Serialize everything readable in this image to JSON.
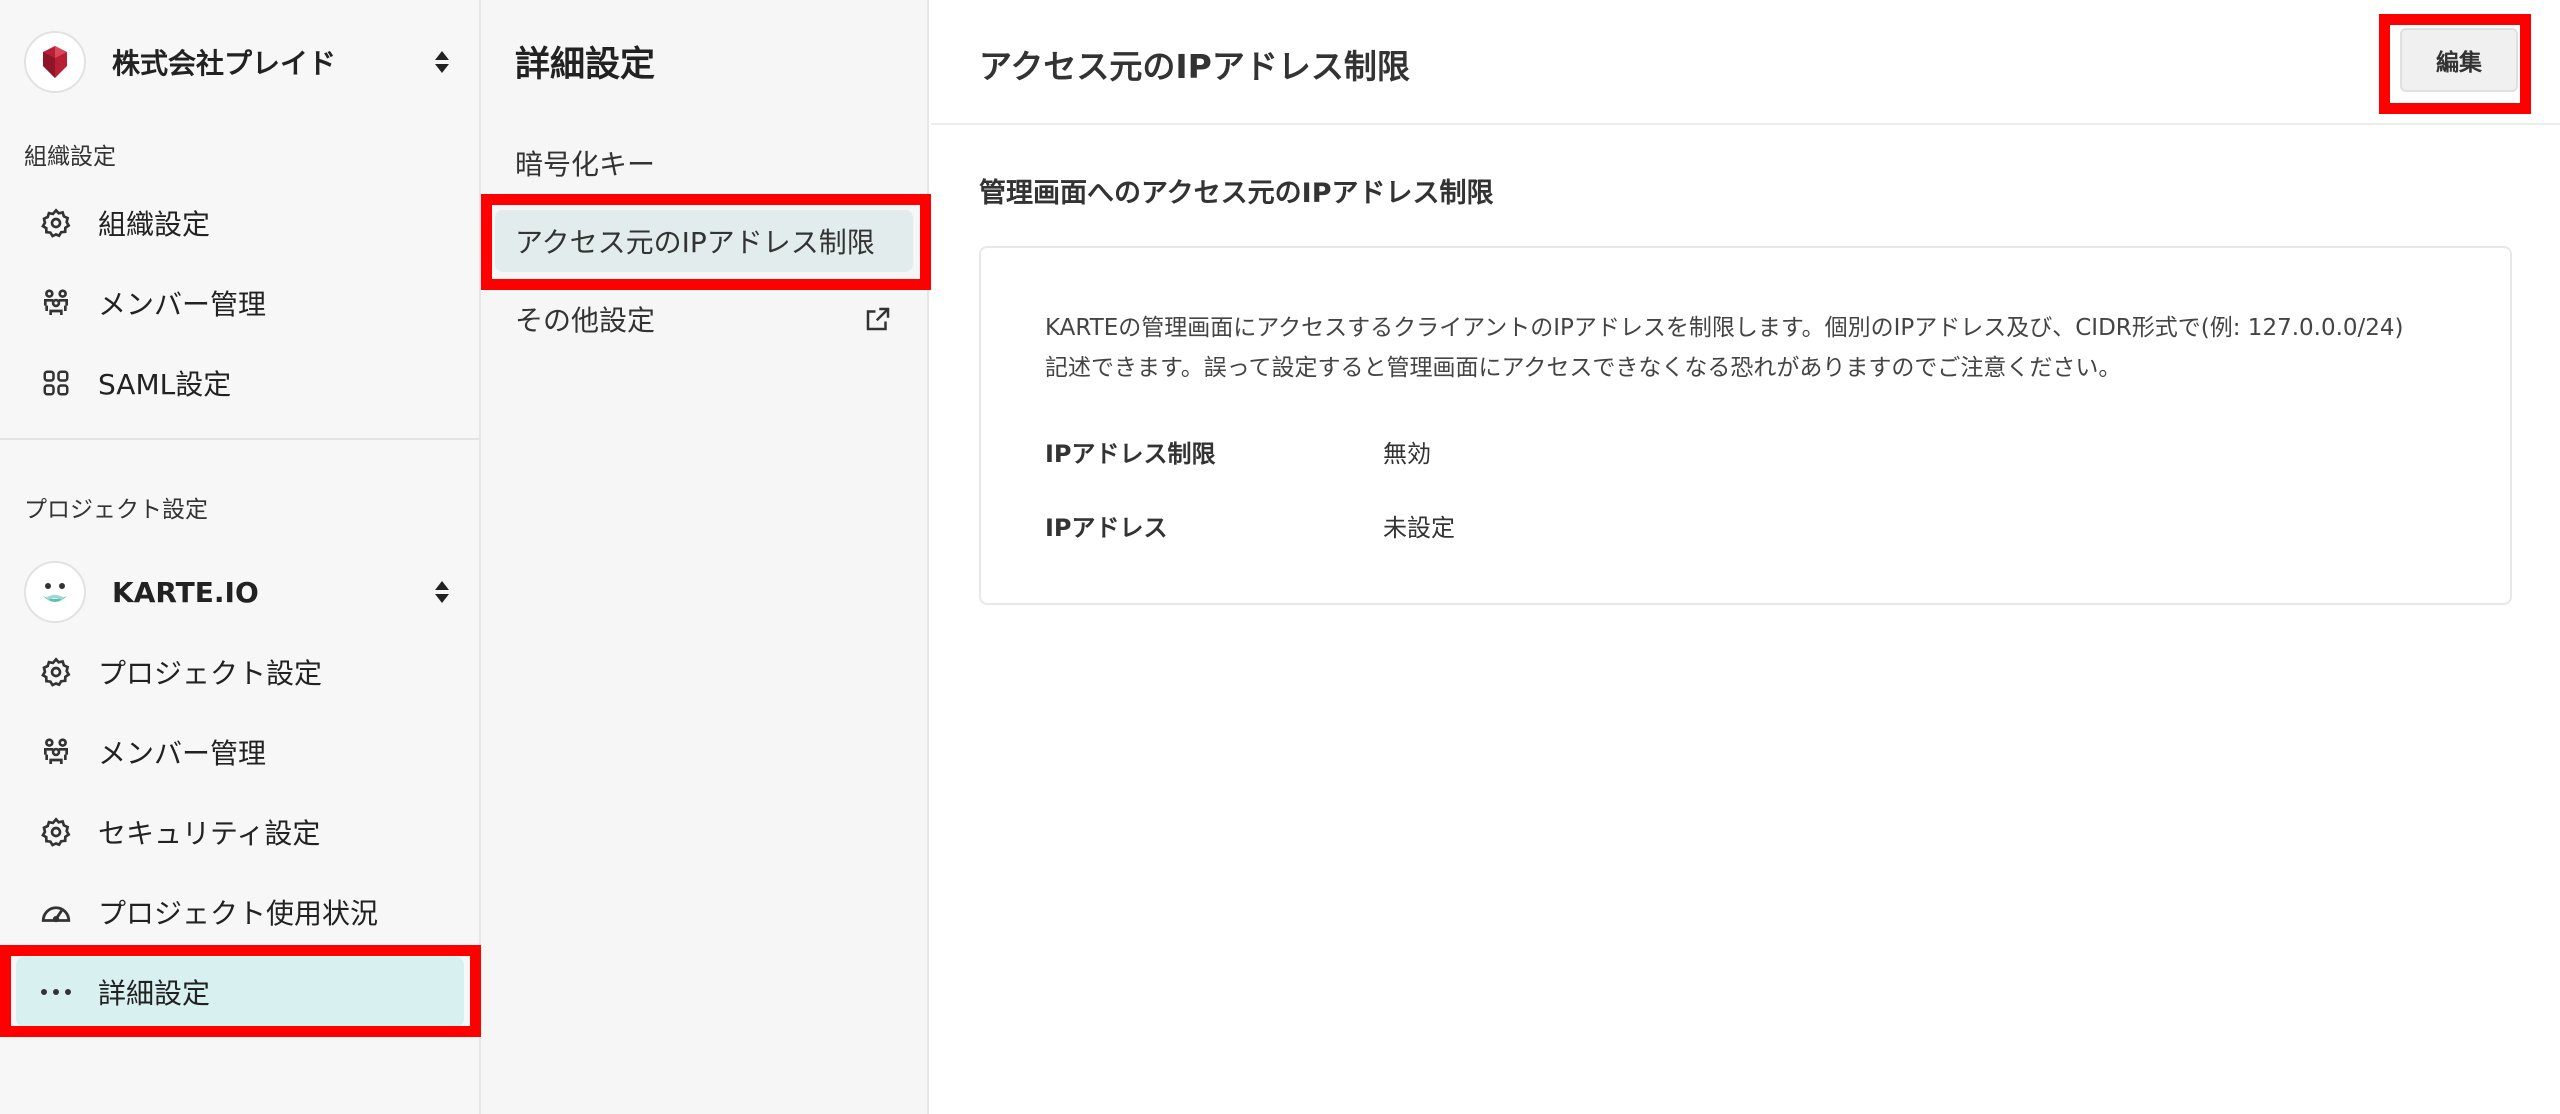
{
  "org": {
    "name": "株式会社プレイド"
  },
  "org_settings": {
    "section_label": "組織設定",
    "items": [
      {
        "label": "組織設定",
        "icon": "gear-icon"
      },
      {
        "label": "メンバー管理",
        "icon": "members-icon"
      },
      {
        "label": "SAML設定",
        "icon": "grid-icon"
      }
    ]
  },
  "project": {
    "section_label": "プロジェクト設定",
    "name": "KARTE.IO",
    "items": [
      {
        "label": "プロジェクト設定",
        "icon": "gear-icon"
      },
      {
        "label": "メンバー管理",
        "icon": "members-icon"
      },
      {
        "label": "セキュリティ設定",
        "icon": "gear-icon"
      },
      {
        "label": "プロジェクト使用状況",
        "icon": "gauge-icon"
      },
      {
        "label": "詳細設定",
        "icon": "more-icon",
        "active": true
      }
    ]
  },
  "submenu": {
    "title": "詳細設定",
    "items": [
      {
        "label": "暗号化キー"
      },
      {
        "label": "アクセス元のIPアドレス制限",
        "active": true
      },
      {
        "label": "その他設定",
        "icon": "external-link-icon"
      }
    ]
  },
  "main": {
    "title": "アクセス元のIPアドレス制限",
    "edit_label": "編集",
    "section_title": "管理画面へのアクセス元のIPアドレス制限",
    "description_line1": "KARTEの管理画面にアクセスするクライアントのIPアドレスを制限します。個別のIPアドレス及び、CIDR形式で(例: 127.0.0.0/24)",
    "description_line2": "記述できます。誤って設定すると管理画面にアクセスできなくなる恐れがありますのでご注意ください。",
    "rows": [
      {
        "label": "IPアドレス制限",
        "value": "無効"
      },
      {
        "label": "IPアドレス",
        "value": "未設定"
      }
    ]
  },
  "colors": {
    "highlight": "#ff0000",
    "active_nav_bg": "#d8f0f0",
    "active_sub_bg": "#e2ecec"
  }
}
